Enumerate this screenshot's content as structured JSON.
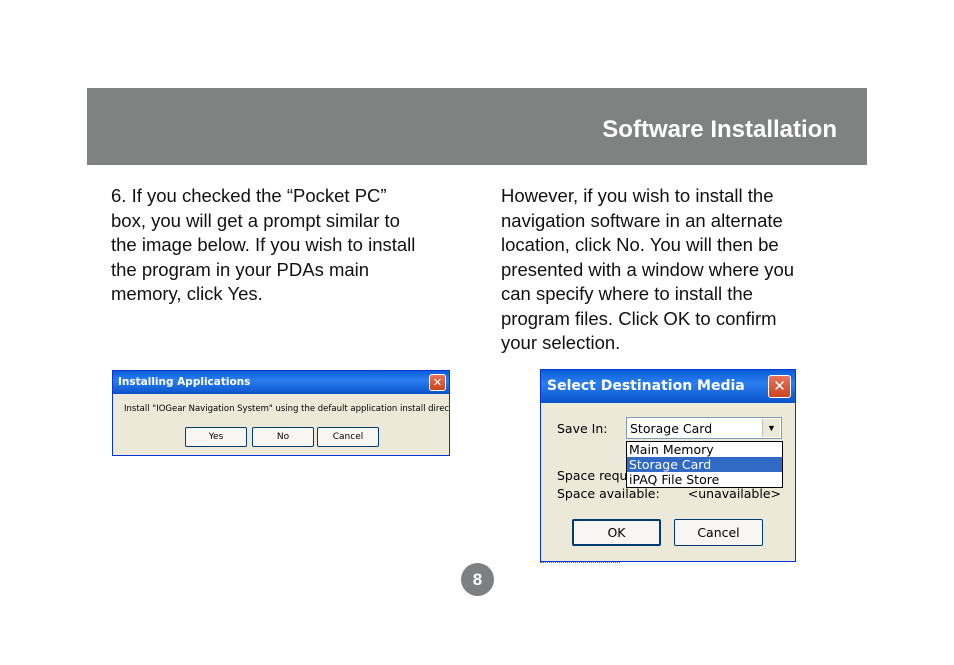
{
  "header": {
    "title": "Software Installation",
    "bar_color": "#808282"
  },
  "left_column": {
    "text": "6.  If you checked the “Pocket PC”\nbox, you will get a prompt similar to\nthe image below.  If you wish to install\nthe program in your PDAs main\nmemory, click Yes."
  },
  "right_column": {
    "text": "However, if you wish to install the\nnavigation software in an alternate\nlocation, click No.  You will then be\npresented with a window where you\ncan specify where to install the\nprogram files.  Click OK to confirm\nyour selection."
  },
  "dialog_install": {
    "title": "Installing Applications",
    "close_icon": "close-icon",
    "message": "Install \"IOGear Navigation System\" using the default application install directory?",
    "yes_label": "Yes",
    "no_label": "No",
    "cancel_label": "Cancel"
  },
  "dialog_destination": {
    "title": "Select Destination Media",
    "close_icon": "close-icon",
    "save_in_label": "Save In:",
    "save_in_value": "Storage Card",
    "options": [
      "Main Memory",
      "Storage Card",
      "iPAQ File Store"
    ],
    "selected_option": "Storage Card",
    "space_required_label": "Space requi",
    "space_available_label": "Space available:",
    "space_available_value": "<unavailable>",
    "ok_label": "OK",
    "cancel_label": "Cancel"
  },
  "page_number": "8",
  "colors": {
    "xp_title_blue": "#0a5fd8",
    "xp_close_red": "#c8461f",
    "dialog_face": "#ece9d8",
    "selection_blue": "#316ac5"
  }
}
